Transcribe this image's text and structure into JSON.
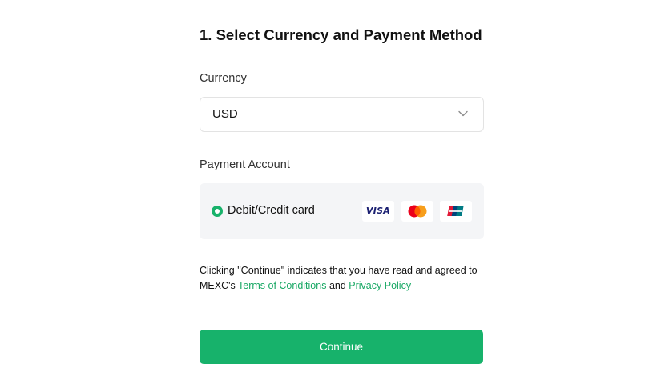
{
  "form": {
    "title": "1. Select Currency and Payment Method",
    "currency_label": "Currency",
    "currency_value": "USD",
    "payment_label": "Payment Account",
    "payment_option": "Debit/Credit card",
    "payment_selected": true,
    "card_brands": [
      "visa-logo",
      "mastercard-logo",
      "unionpay-logo"
    ],
    "visa_text": "VISA",
    "consent_prefix": "Clicking \"Continue\" indicates that you have read and agreed to MEXC's ",
    "terms_link": "Terms of Conditions",
    "consent_and": " and ",
    "privacy_link": "Privacy Policy",
    "continue_label": "Continue"
  },
  "colors": {
    "accent": "#17b26b",
    "card_background": "#f4f5f7",
    "border": "#e3e3e3"
  }
}
